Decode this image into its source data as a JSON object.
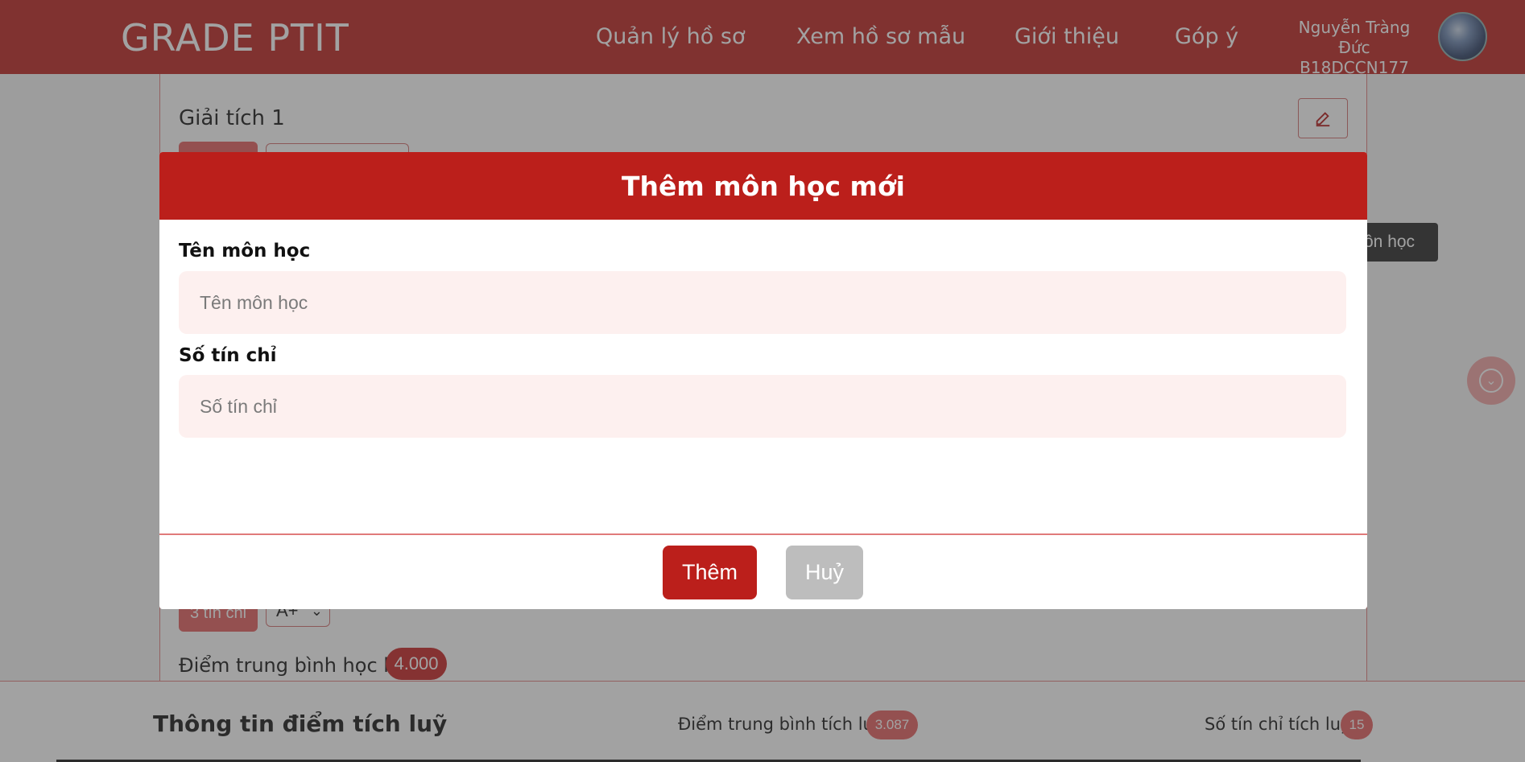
{
  "header": {
    "logo": "GRADE PTIT",
    "nav": [
      "Quản lý hồ sơ",
      "Xem hồ sơ mẫu",
      "Giới thiệu",
      "Góp ý"
    ],
    "user_name": "Nguyễn Tràng Đức",
    "user_id": "B18DCCN177"
  },
  "background": {
    "subject_title": "Giải tích 1",
    "side_button_label": "ôn học",
    "credits_tag": "3 tín chỉ",
    "grade_value": "A+",
    "semester_avg_label": "Điểm trung bình học kì:",
    "semester_avg_value": "4.000"
  },
  "footer": {
    "title": "Thông tin điểm tích luỹ",
    "avg_label": "Điểm trung bình tích luỹ:",
    "avg_value": "3.087",
    "credits_label": "Số tín chỉ tích luỹ:",
    "credits_value": "15"
  },
  "modal": {
    "title": "Thêm môn học mới",
    "fields": [
      {
        "label": "Tên môn học",
        "placeholder": "Tên môn học",
        "value": ""
      },
      {
        "label": "Số tín chỉ",
        "placeholder": "Số tín chỉ",
        "value": ""
      }
    ],
    "add_label": "Thêm",
    "cancel_label": "Huỷ"
  },
  "icons": {
    "edit": "pencil-icon",
    "scroll": "chevron-down-icon"
  },
  "colors": {
    "brand": "#bb1f1b",
    "input_bg": "#fdf0ef",
    "cancel_bg": "#bdbdbd"
  }
}
